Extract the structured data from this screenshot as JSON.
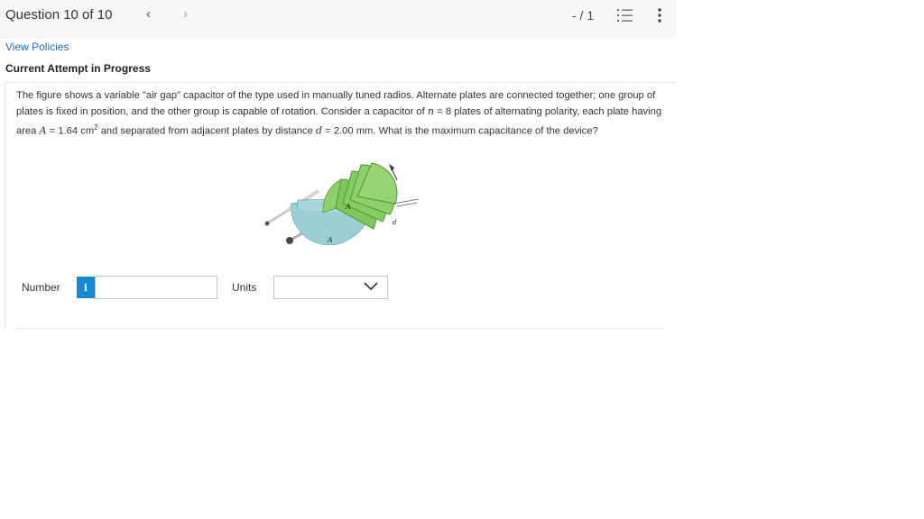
{
  "header": {
    "question_label": "Question 10 of 10",
    "score": "- / 1",
    "prev_icon": "chevron-left-icon",
    "next_icon": "chevron-right-icon",
    "list_icon": "numbered-list-icon",
    "more_icon": "more-vertical-icon"
  },
  "links": {
    "view_policies": "View Policies"
  },
  "status": {
    "attempt": "Current Attempt in Progress"
  },
  "question": {
    "part1": "The figure shows a variable \"air gap\" capacitor of the type used in manually tuned radios. Alternate plates are connected together; one group of plates is fixed in position, and the other group is capable of rotation. Consider a capacitor of ",
    "var_n": "n",
    "part2": " = 8 plates of alternating polarity, each plate having area ",
    "var_A": "A",
    "part3": " = 1.64 cm",
    "exp": "2",
    "part4": " and separated from adjacent plates by distance ",
    "var_d": "d",
    "part5": " = 2.00 mm. What is the maximum capacitance of the device?"
  },
  "figure": {
    "label_A_top": "A",
    "label_A_bottom": "A",
    "label_d": "d",
    "colors": {
      "fixed_plates": "#9fd0d6",
      "rotating_plates": "#8fcf6a",
      "rod": "#b8b8b8"
    }
  },
  "answer": {
    "number_label": "Number",
    "number_value": "",
    "info_glyph": "i",
    "units_label": "Units",
    "units_selected": "",
    "accent": "#1b88d6"
  }
}
